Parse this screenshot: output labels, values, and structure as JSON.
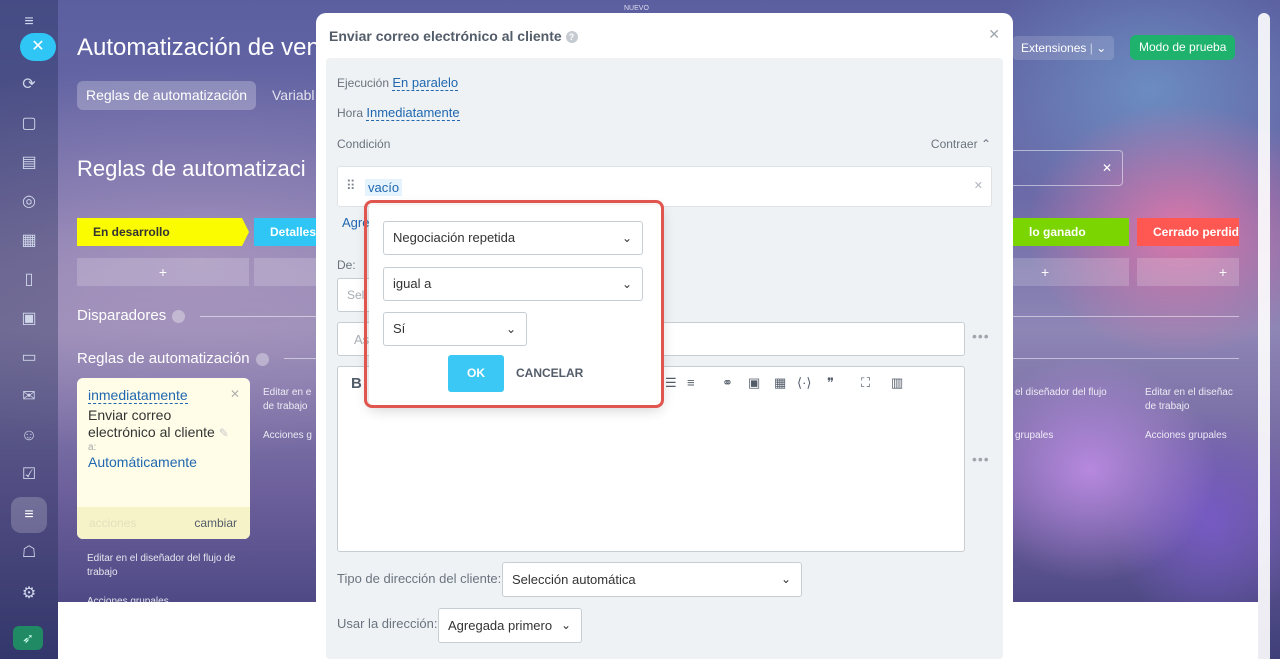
{
  "top_label": "NUEVO",
  "sidebar": {
    "close_glyph": "✕"
  },
  "background": {
    "page_title": "Automatización de vent",
    "tab_rules": "Reglas de automatización",
    "tab_vars": "Variabl",
    "sub_title": "Reglas de automatizaci",
    "stages": [
      "En desarrollo",
      "Detalles",
      "lo ganado",
      "Cerrado perdid"
    ],
    "plus": "+",
    "triggers_label": "Disparadores",
    "rules_label": "Reglas de automatización",
    "extensions": "Extensiones",
    "test_mode": "Modo de prueba",
    "rule_card": {
      "timing": "inmediatamente",
      "title": "Enviar correo electrónico al cliente",
      "to_label": "a:",
      "to_value": "Automáticamente",
      "actions": "acciones",
      "change": "cambiar"
    },
    "edit_designer": "Editar en el diseñador del flujo de trabajo",
    "edit_short": "Editar en e de trabajo",
    "group_short": "Acciones g",
    "group_actions": "Acciones grupales",
    "edit_right1": "el diseñador del flujo",
    "group_right1": "grupales",
    "edit_right2": "Editar en el diseñac de trabajo",
    "group_right2": "Acciones grupales"
  },
  "modal": {
    "title": "Enviar correo electrónico al cliente",
    "execution_label": "Ejecución",
    "execution_value": "En paralelo",
    "time_label": "Hora",
    "time_value": "Inmediatamente",
    "condition_label": "Condición",
    "collapse": "Contraer",
    "condition_tag": "vacío",
    "add_partial": "Agre",
    "from_label": "De:",
    "from_placeholder": "Sel",
    "subject_partial": "As",
    "bold": "B",
    "client_dir_label": "Tipo de dirección del cliente:",
    "client_dir_value": "Selección automática",
    "use_dir_label": "Usar la dirección:",
    "use_dir_value": "Agregada primero"
  },
  "popup": {
    "field": "Negociación repetida",
    "operator": "igual a",
    "value": "Sí",
    "ok": "OK",
    "cancel": "CANCELAR"
  }
}
